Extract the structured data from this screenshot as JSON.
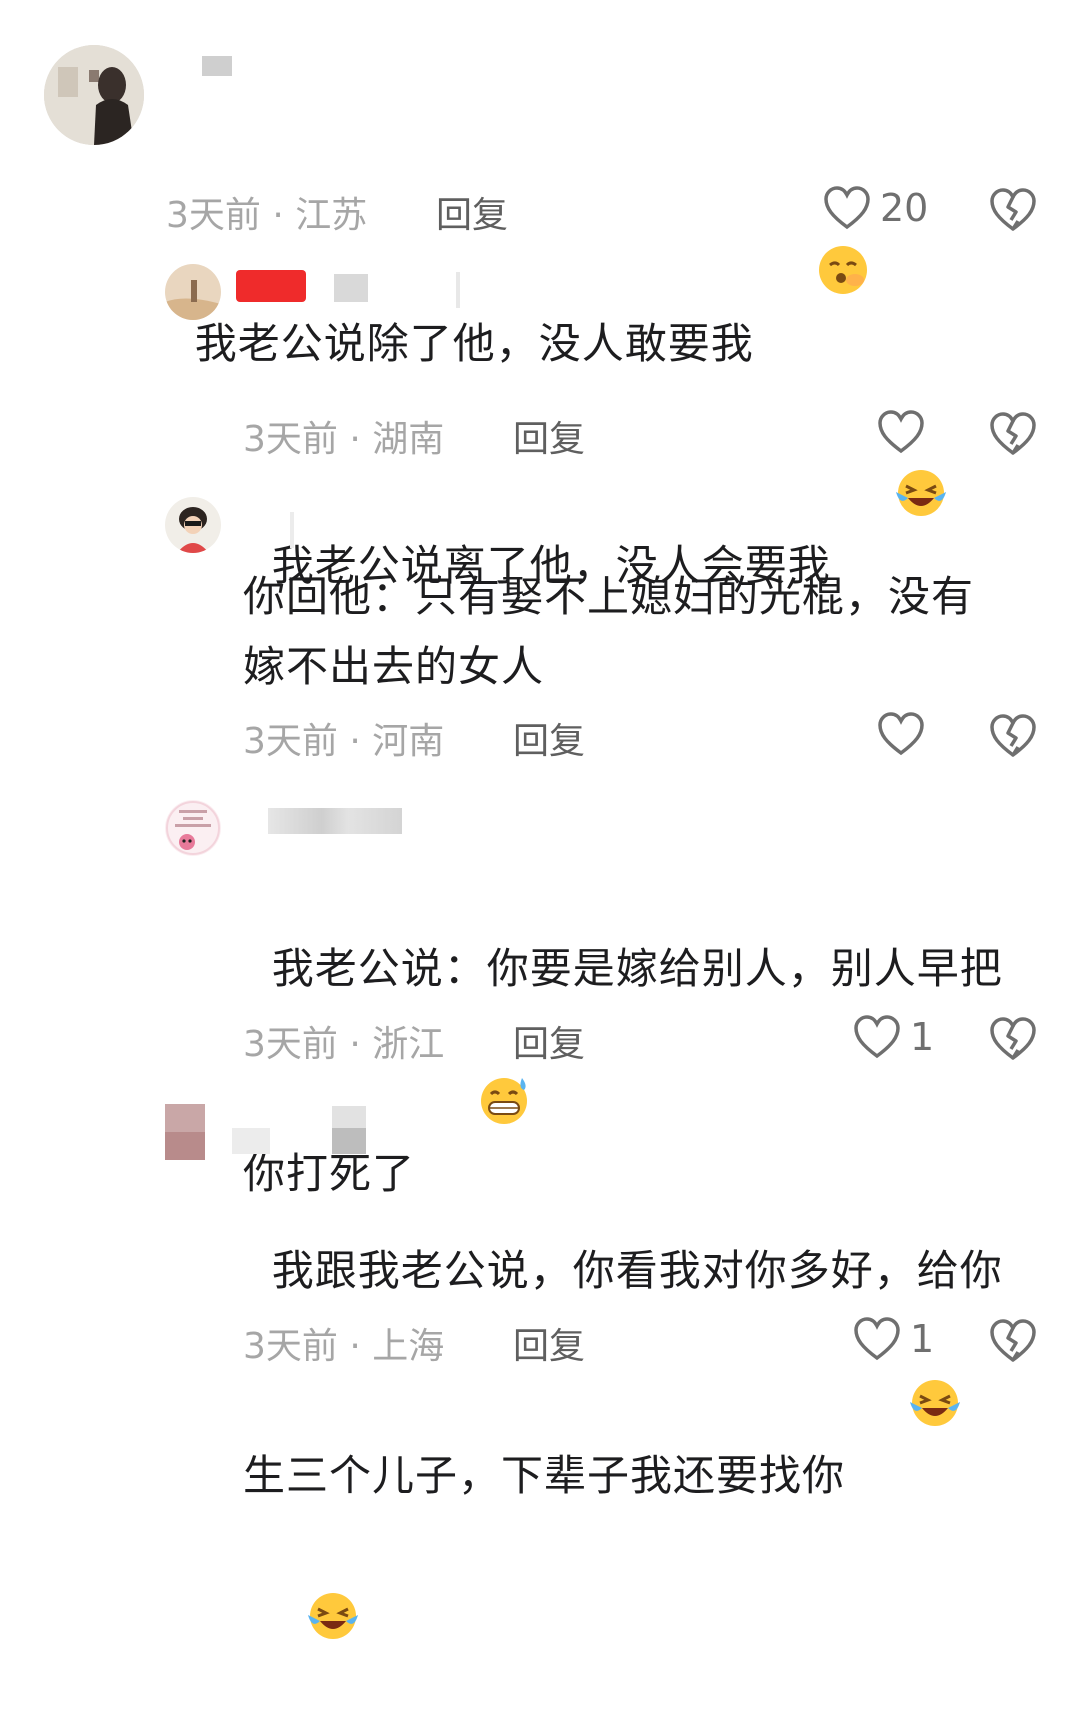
{
  "comments": [
    {
      "text": "我老公说除了他，没人敢要我",
      "meta": "3天前 · 江苏",
      "reply": "回复",
      "likes": "20",
      "emoji": "kissing-face"
    },
    {
      "text": "我老公说离了他，没人会要我",
      "meta": "3天前 · 湖南",
      "reply": "回复",
      "likes": "",
      "emoji": "laughing-crying-face"
    },
    {
      "text": "你回他：只有娶不上媳妇的光棍，没有\n嫁不出去的女人",
      "meta": "3天前 · 河南",
      "reply": "回复",
      "likes": ""
    },
    {
      "text": "我老公说：你要是嫁给别人，别人早把\n你打死了",
      "meta": "3天前 · 浙江",
      "reply": "回复",
      "likes": "1",
      "emoji": "grinning-sweat-face"
    },
    {
      "text": "我跟我老公说，你看我对你多好，给你\n生三个儿子，下辈子我还要找你",
      "meta": "3天前 · 上海",
      "reply": "回复",
      "likes": "1",
      "emoji": "laughing-crying-face x2"
    }
  ]
}
